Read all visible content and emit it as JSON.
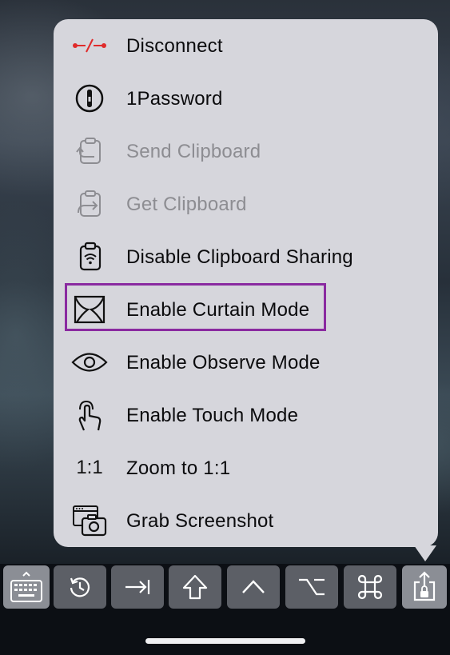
{
  "menu": {
    "items": [
      {
        "label": "Disconnect",
        "icon": "disconnect-icon",
        "enabled": true
      },
      {
        "label": "1Password",
        "icon": "1password-icon",
        "enabled": true
      },
      {
        "label": "Send Clipboard",
        "icon": "send-clipboard-icon",
        "enabled": false
      },
      {
        "label": "Get Clipboard",
        "icon": "get-clipboard-icon",
        "enabled": false
      },
      {
        "label": "Disable Clipboard Sharing",
        "icon": "clipboard-sharing-icon",
        "enabled": true
      },
      {
        "label": "Enable Curtain Mode",
        "icon": "curtain-icon",
        "enabled": true,
        "highlighted": true
      },
      {
        "label": "Enable Observe Mode",
        "icon": "eye-icon",
        "enabled": true
      },
      {
        "label": "Enable Touch Mode",
        "icon": "touch-hand-icon",
        "enabled": true
      },
      {
        "label": "Zoom to 1:1",
        "icon": "zoom-1-1-icon",
        "icon_text": "1:1",
        "enabled": true
      },
      {
        "label": "Grab Screenshot",
        "icon": "screenshot-camera-icon",
        "enabled": true
      }
    ]
  },
  "toolbar": {
    "buttons": [
      {
        "name": "keyboard",
        "icon": "keyboard-icon"
      },
      {
        "name": "history",
        "icon": "history-icon"
      },
      {
        "name": "tab",
        "icon": "tab-key-icon"
      },
      {
        "name": "shift",
        "icon": "shift-key-icon"
      },
      {
        "name": "control",
        "icon": "control-key-icon"
      },
      {
        "name": "option",
        "icon": "option-key-icon"
      },
      {
        "name": "command",
        "icon": "command-key-icon"
      },
      {
        "name": "share",
        "icon": "share-lock-icon"
      }
    ]
  },
  "colors": {
    "menu_bg": "#d6d6dc",
    "highlight_border": "#8a2aa0",
    "disconnect_red": "#e02b2b",
    "disabled_text": "#8d8d92"
  }
}
